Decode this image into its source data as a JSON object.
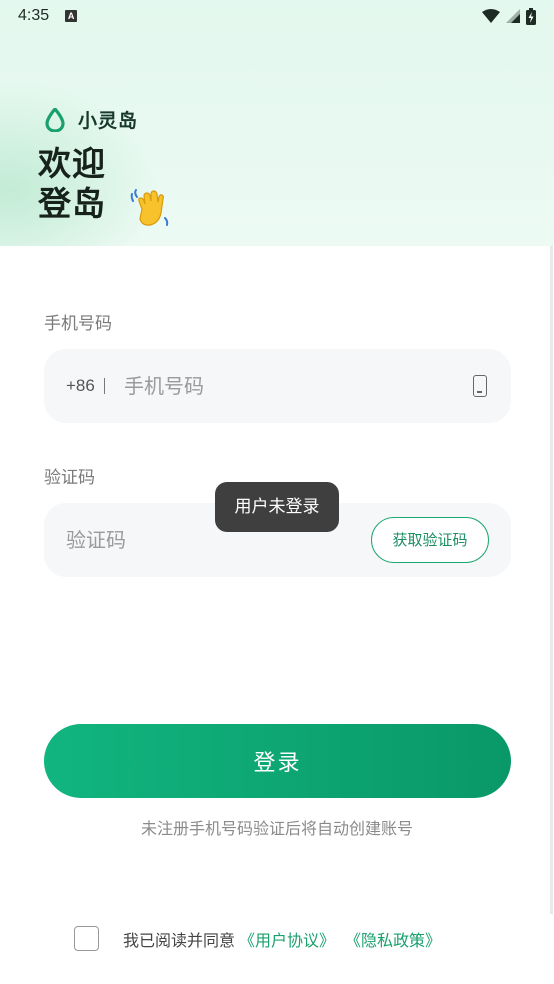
{
  "status_bar": {
    "time": "4:35",
    "notification_letter": "A"
  },
  "brand": {
    "name": "小灵岛",
    "accent": "#1aa06d"
  },
  "welcome": {
    "line1": "欢迎",
    "line2": "登岛",
    "emoji_icon": "waving-hand-icon"
  },
  "phone": {
    "label": "手机号码",
    "prefix": "+86",
    "placeholder": "手机号码",
    "icon": "mobile-phone-icon"
  },
  "code": {
    "label": "验证码",
    "placeholder": "验证码",
    "button": "获取验证码"
  },
  "toast": "用户未登录",
  "login": {
    "button": "登录",
    "hint": "未注册手机号码验证后将自动创建账号",
    "gradient_start": "#11b57f",
    "gradient_end": "#0a9868"
  },
  "agreement": {
    "text": "我已阅读并同意",
    "user_agreement": "《用户协议》",
    "privacy_policy": "《隐私政策》"
  }
}
